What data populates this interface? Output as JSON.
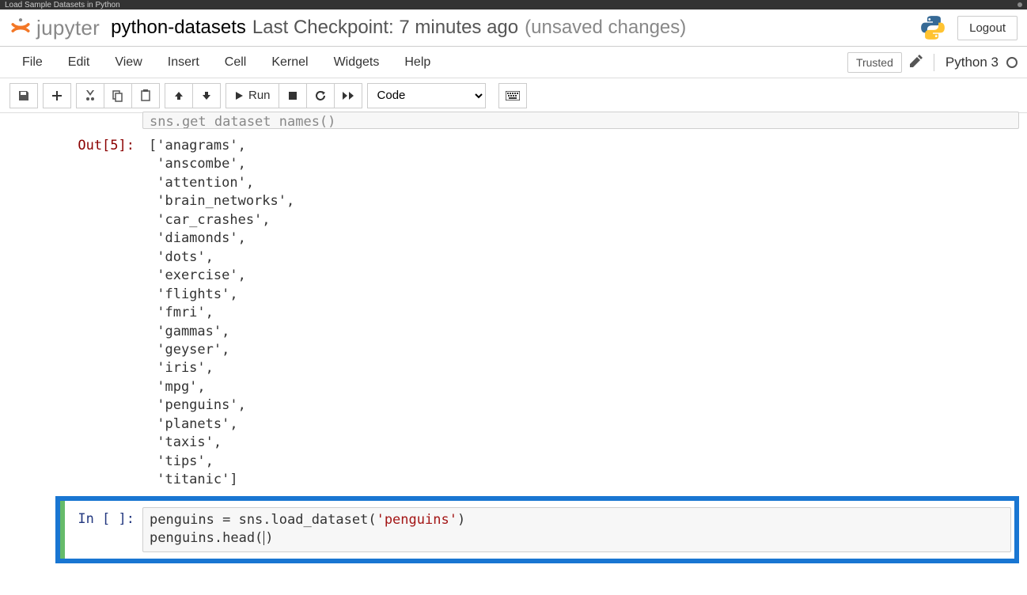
{
  "browser_tab": "Load Sample Datasets in Python",
  "logo_text": "jupyter",
  "notebook_name": "python-datasets",
  "checkpoint_text": "Last Checkpoint: 7 minutes ago",
  "unsaved_text": "(unsaved changes)",
  "logout_label": "Logout",
  "menus": [
    "File",
    "Edit",
    "View",
    "Insert",
    "Cell",
    "Kernel",
    "Widgets",
    "Help"
  ],
  "trusted_label": "Trusted",
  "kernel_name": "Python 3",
  "toolbar": {
    "run_label": "Run",
    "cell_type_selected": "Code"
  },
  "truncated_input": "sns.get_dataset_names()",
  "output_prompt": "Out[5]:",
  "output_lines": [
    "['anagrams',",
    " 'anscombe',",
    " 'attention',",
    " 'brain_networks',",
    " 'car_crashes',",
    " 'diamonds',",
    " 'dots',",
    " 'exercise',",
    " 'flights',",
    " 'fmri',",
    " 'gammas',",
    " 'geyser',",
    " 'iris',",
    " 'mpg',",
    " 'penguins',",
    " 'planets',",
    " 'taxis',",
    " 'tips',",
    " 'titanic']"
  ],
  "input_prompt": "In [ ]:",
  "input_code": {
    "line1_pre": "penguins = sns.load_dataset(",
    "line1_str": "'penguins'",
    "line1_post": ")",
    "line2_pre": "penguins.head(",
    "line2_post": ")"
  }
}
